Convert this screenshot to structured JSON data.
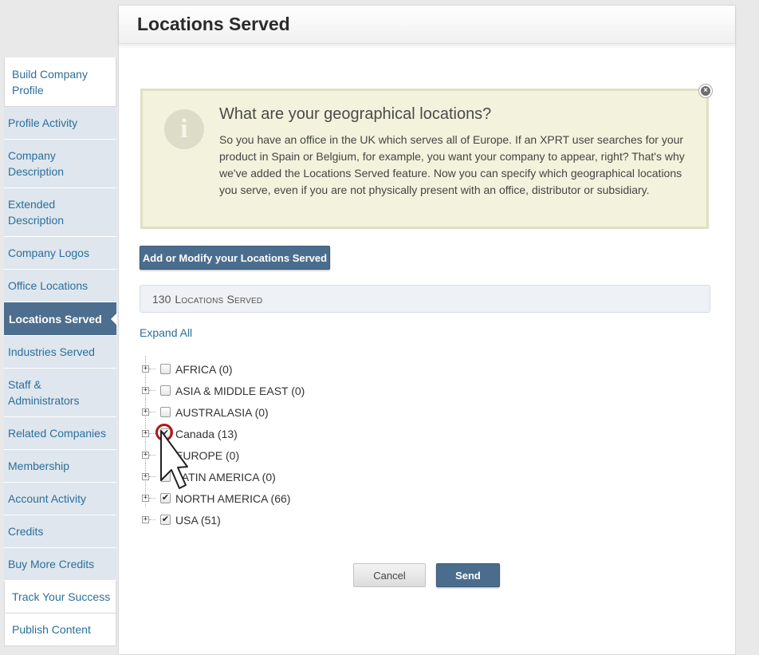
{
  "page": {
    "title": "Locations Served"
  },
  "sidebar": {
    "items": [
      {
        "label": "Build Company Profile"
      },
      {
        "label": "Profile Activity"
      },
      {
        "label": "Company Description"
      },
      {
        "label": "Extended Description"
      },
      {
        "label": "Company Logos"
      },
      {
        "label": "Office Locations"
      },
      {
        "label": "Locations Served"
      },
      {
        "label": "Industries Served"
      },
      {
        "label": "Staff & Administrators"
      },
      {
        "label": "Related Companies"
      },
      {
        "label": "Membership"
      },
      {
        "label": "Account Activity"
      },
      {
        "label": "Credits"
      },
      {
        "label": "Buy More Credits"
      },
      {
        "label": "Track Your Success"
      },
      {
        "label": "Publish Content"
      }
    ],
    "active": "Locations Served"
  },
  "info": {
    "title": "What are your geographical locations?",
    "text": "So you have an office in the UK which serves all of Europe. If an XPRT user searches for your product in Spain or Belgium, for example, you want your company to appear, right? That's why we've added the Locations Served feature. Now you can specify which geographical locations you serve, even if you are not physically present with an office, distributor or subsidiary.",
    "icon": "i",
    "close": "×"
  },
  "actions": {
    "modify_label": "Add or Modify your Locations Served",
    "count_number": "130",
    "count_label": "Locations Served",
    "expand_all": "Expand All",
    "cancel": "Cancel",
    "send": "Send"
  },
  "tree": {
    "rows": [
      {
        "label": "AFRICA (0)",
        "checked": false
      },
      {
        "label": "ASIA & MIDDLE EAST (0)",
        "checked": false
      },
      {
        "label": "AUSTRALASIA (0)",
        "checked": false
      },
      {
        "label": "Canada (13)",
        "checked": true
      },
      {
        "label": "EUROPE (0)",
        "checked": false
      },
      {
        "label": "LATIN AMERICA (0)",
        "checked": false
      },
      {
        "label": "NORTH AMERICA (66)",
        "checked": true
      },
      {
        "label": "USA (51)",
        "checked": true
      }
    ]
  },
  "colors": {
    "accent": "#4b6d8d",
    "link": "#2a6f9a",
    "highlight_ring": "#b01818",
    "info_bg": "#f3f3dd"
  }
}
